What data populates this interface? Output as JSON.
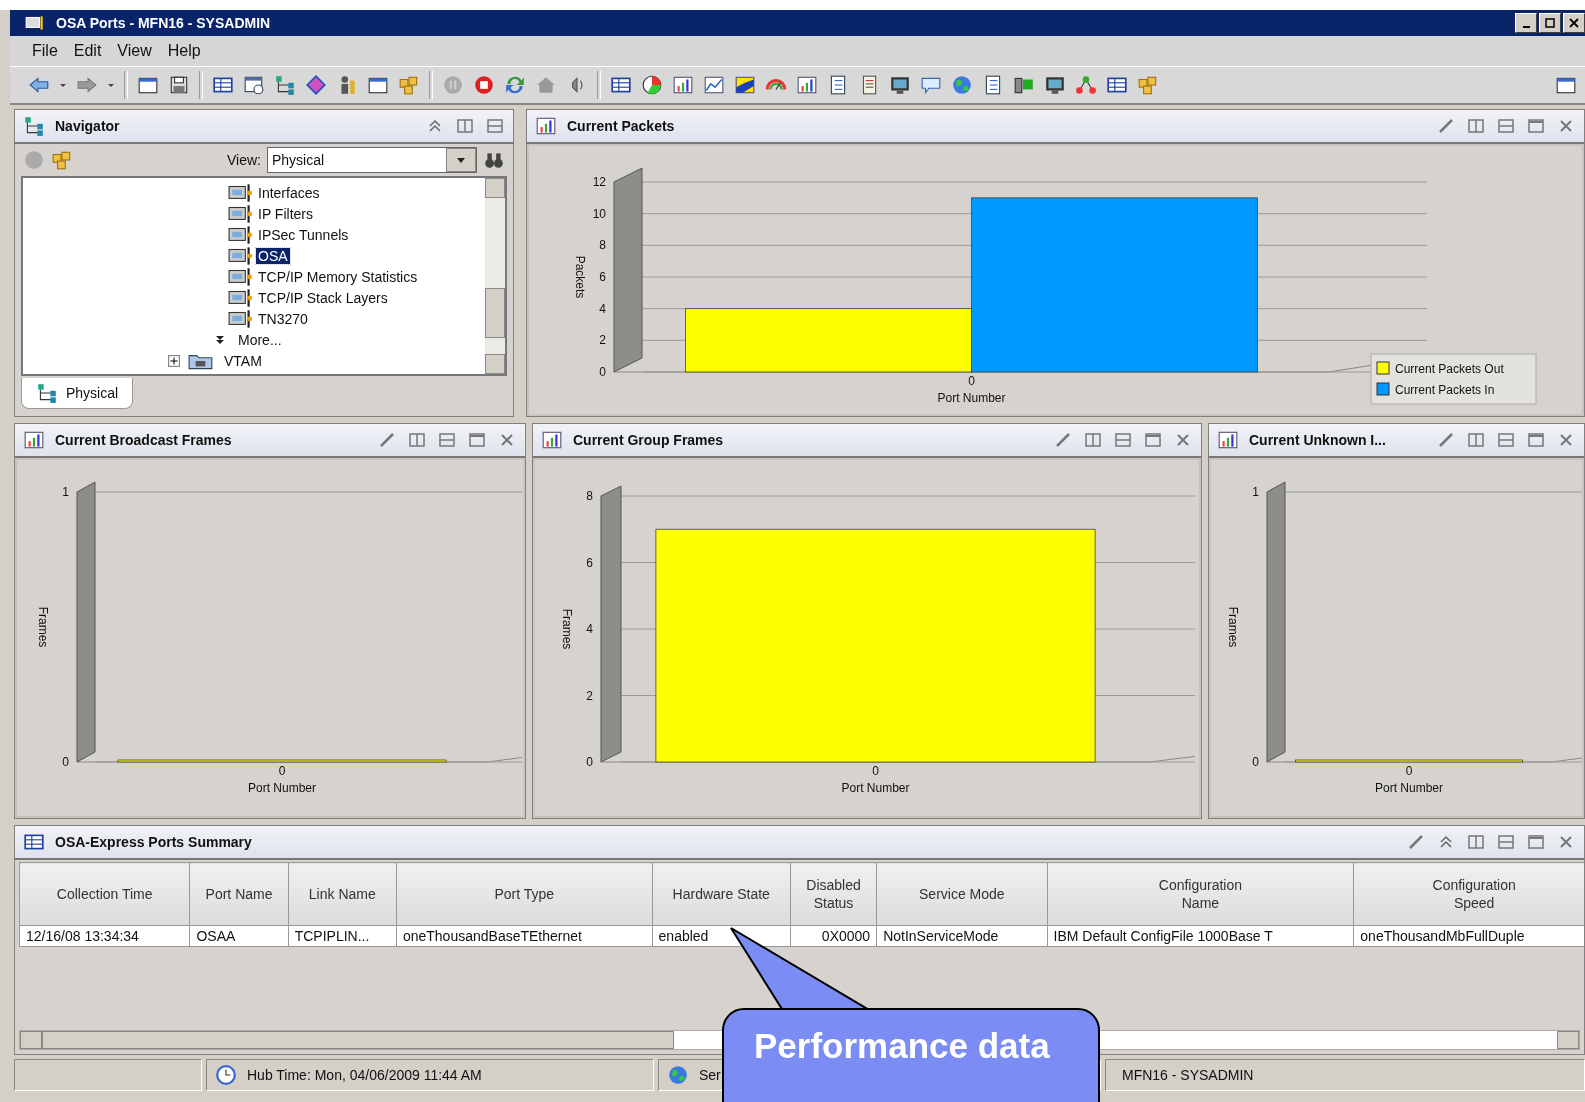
{
  "window": {
    "title": "OSA Ports - MFN16 - SYSADMIN"
  },
  "menu": [
    "File",
    "Edit",
    "View",
    "Help"
  ],
  "navigator": {
    "title": "Navigator",
    "view_label": "View:",
    "view_value": "Physical",
    "tree": [
      {
        "label": "Interfaces",
        "selected": false
      },
      {
        "label": "IP Filters",
        "selected": false
      },
      {
        "label": "IPSec Tunnels",
        "selected": false
      },
      {
        "label": "OSA",
        "selected": true
      },
      {
        "label": "TCP/IP Memory Statistics",
        "selected": false
      },
      {
        "label": "TCP/IP Stack Layers",
        "selected": false
      },
      {
        "label": "TN3270",
        "selected": false
      }
    ],
    "more": "More...",
    "folder": {
      "label": "VTAM",
      "expanded": false
    },
    "tab": {
      "label": "Physical",
      "selected": true
    }
  },
  "charts": [
    {
      "title": "Current Packets",
      "chart_data": {
        "type": "bar",
        "xlabel": "Port Number",
        "ylabel": "Packets",
        "categories": [
          "0"
        ],
        "series": [
          {
            "name": "Current Packets Out",
            "color": "#ffff00",
            "values": [
              4
            ]
          },
          {
            "name": "Current Packets In",
            "color": "#0099ff",
            "values": [
              11
            ]
          }
        ],
        "ylim": [
          0,
          12
        ],
        "yticks": [
          0,
          2,
          4,
          6,
          8,
          10,
          12
        ],
        "grid": true,
        "legend": "right"
      }
    },
    {
      "title": "Current Broadcast Frames",
      "chart_data": {
        "type": "bar",
        "xlabel": "Port Number",
        "ylabel": "Frames",
        "categories": [
          "0"
        ],
        "series": [
          {
            "color": "#ffff00",
            "values": [
              0
            ]
          }
        ],
        "ylim": [
          0,
          1
        ],
        "yticks": [
          0,
          1
        ],
        "grid": true
      }
    },
    {
      "title": "Current Group Frames",
      "chart_data": {
        "type": "bar",
        "xlabel": "Port Number",
        "ylabel": "Frames",
        "categories": [
          "0"
        ],
        "series": [
          {
            "color": "#ffff00",
            "values": [
              7
            ]
          }
        ],
        "ylim": [
          0,
          8
        ],
        "yticks": [
          0,
          2,
          4,
          6,
          8
        ],
        "grid": true
      }
    },
    {
      "title": "Current Unknown I...",
      "chart_data": {
        "type": "bar",
        "xlabel": "Port Number",
        "ylabel": "Frames",
        "categories": [
          "0"
        ],
        "series": [
          {
            "color": "#ffff00",
            "values": [
              0
            ]
          }
        ],
        "ylim": [
          0,
          1
        ],
        "yticks": [
          0,
          1
        ],
        "grid": true
      }
    }
  ],
  "table": {
    "title": "OSA-Express Ports Summary",
    "columns": [
      "Collection Time",
      "Port Name",
      "Link Name",
      "Port Type",
      "Hardware State",
      "Disabled\nStatus",
      "Service Mode",
      "Configuration\nName",
      "Configuration\nSpeed"
    ],
    "rows": [
      [
        "12/16/08 13:34:34",
        "OSAA",
        "TCPIPLIN...",
        "oneThousandBaseTEthernet",
        "enabled",
        "0X0000",
        "NotInServiceMode",
        "IBM Default ConfigFile  1000Base T",
        "oneThousandMbFullDuple"
      ]
    ]
  },
  "status_bar": {
    "hub_time": "Hub Time: Mon, 04/06/2009 11:44 AM",
    "server": "Ser",
    "user": "MFN16 - SYSADMIN"
  },
  "callout": "Performance data"
}
